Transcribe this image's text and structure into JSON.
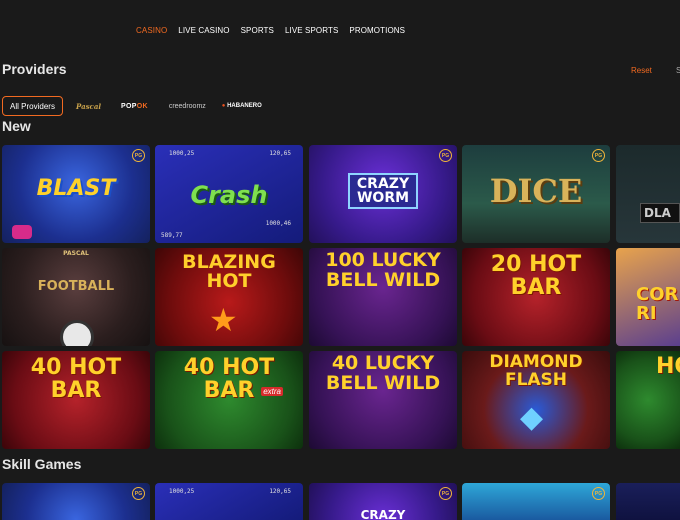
{
  "nav": {
    "items": [
      {
        "label": "CASINO",
        "active": true
      },
      {
        "label": "LIVE CASINO"
      },
      {
        "label": "SPORTS"
      },
      {
        "label": "LIVE SPORTS"
      },
      {
        "label": "PROMOTIONS"
      }
    ]
  },
  "providers": {
    "title": "Providers",
    "reset_label": "Reset",
    "all_label": "All Providers",
    "logos": [
      "Pascal",
      "POPOK",
      "creedroomz",
      "HABANERO"
    ]
  },
  "sections": {
    "new_title": "New",
    "skill_title": "Skill Games"
  },
  "games": {
    "blast": {
      "title": "BLAST",
      "badge": "PG"
    },
    "crash": {
      "title": "Crash",
      "top_left": "1000,25",
      "top_right": "120,65",
      "bottom_left": "589,77",
      "bottom_right": "1000,46"
    },
    "crazy_worm": {
      "title": "CRAZY WORM",
      "badge": "PG"
    },
    "dice": {
      "title": "DICE",
      "badge": "PG"
    },
    "partial1": {
      "title": "DLA"
    },
    "football": {
      "title": "FOOTBALL",
      "brand": "PASCAL"
    },
    "blazing_hot": {
      "title": "BLAZING HOT"
    },
    "lucky_bell_100": {
      "title": "100 LUCKY BELL WILD"
    },
    "hot_bar_20": {
      "title": "20 HOT BAR"
    },
    "partial2": {
      "title": "COR RI"
    },
    "hot_bar_40": {
      "title": "40 HOT BAR"
    },
    "hot_bar_40_extra": {
      "title": "40 HOT BAR",
      "tag": "extra"
    },
    "lucky_bell_40": {
      "title": "40 LUCKY BELL WILD"
    },
    "diamond_flash": {
      "title": "DIAMOND FLASH"
    },
    "partial3": {
      "title": "HO"
    }
  },
  "colors": {
    "accent": "#f26a21",
    "background": "#1a1a1a",
    "gold": "#f0b53a"
  }
}
